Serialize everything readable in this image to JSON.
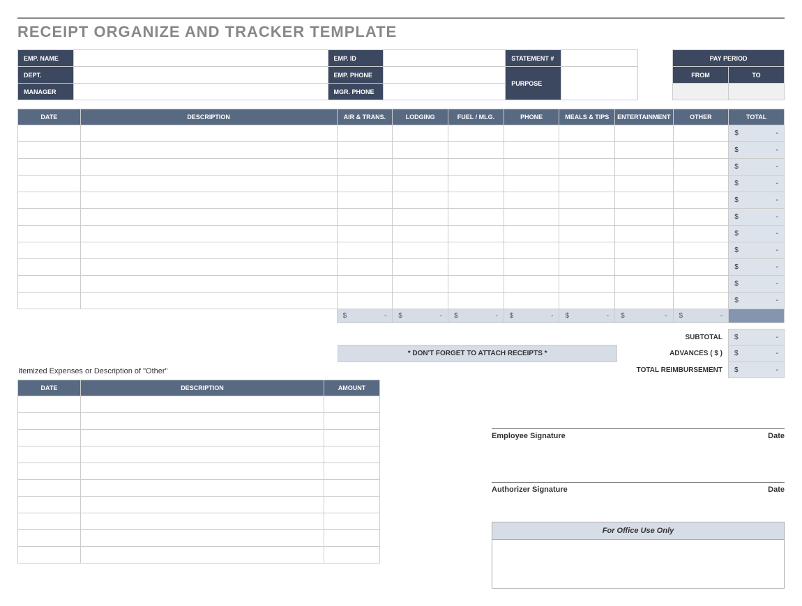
{
  "title": "RECEIPT ORGANIZE AND TRACKER TEMPLATE",
  "header": {
    "emp_name_lbl": "EMP. NAME",
    "emp_id_lbl": "EMP. ID",
    "statement_lbl": "STATEMENT #",
    "pay_period_lbl": "PAY PERIOD",
    "dept_lbl": "DEPT.",
    "emp_phone_lbl": "EMP. PHONE",
    "purpose_lbl": "PURPOSE",
    "from_lbl": "FROM",
    "to_lbl": "TO",
    "manager_lbl": "MANAGER",
    "mgr_phone_lbl": "MGR. PHONE"
  },
  "columns": {
    "date": "DATE",
    "description": "DESCRIPTION",
    "air": "AIR & TRANS.",
    "lodging": "LODGING",
    "fuel": "FUEL / MLG.",
    "phone": "PHONE",
    "meals": "MEALS & TIPS",
    "ent": "ENTERTAINMENT",
    "other": "OTHER",
    "total": "TOTAL",
    "amount": "AMOUNT"
  },
  "money": {
    "sym": "$",
    "dash": "-"
  },
  "summary": {
    "reminder": "* DON'T FORGET TO ATTACH RECEIPTS *",
    "subtotal_lbl": "SUBTOTAL",
    "advances_lbl": "ADVANCES  ( $ )",
    "total_reimb_lbl": "TOTAL REIMBURSEMENT"
  },
  "itemized_caption": "Itemized Expenses or Description of \"Other\"",
  "signatures": {
    "emp": "Employee Signature",
    "auth": "Authorizer Signature",
    "date": "Date"
  },
  "office_use": "For Office Use Only"
}
